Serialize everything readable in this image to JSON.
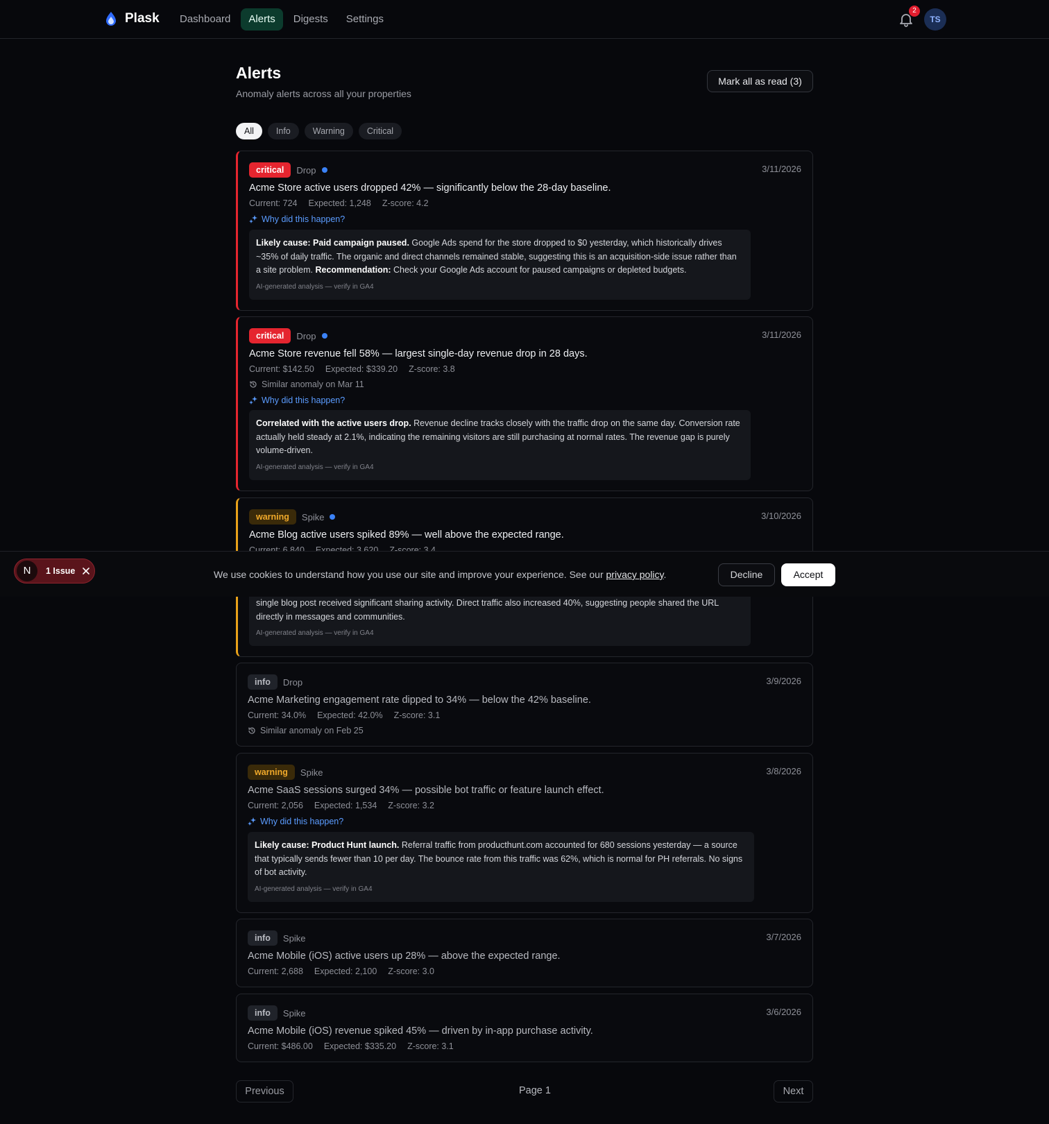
{
  "nav": {
    "brand": "Plask",
    "links": [
      "Dashboard",
      "Alerts",
      "Digests",
      "Settings"
    ],
    "notification_count": "2",
    "avatar_initials": "TS"
  },
  "header": {
    "title": "Alerts",
    "subtitle": "Anomaly alerts across all your properties",
    "mark_all_label": "Mark all as read (3)"
  },
  "filters": [
    "All",
    "Info",
    "Warning",
    "Critical"
  ],
  "alerts": [
    {
      "severity": "critical",
      "kind": "Drop",
      "date": "3/11/2026",
      "title": "Acme Store active users dropped 42% — significantly below the 28-day baseline.",
      "current": "Current: 724",
      "expected": "Expected: 1,248",
      "zscore": "Z-score: 4.2",
      "why": "Why did this happen?",
      "analysis_lead": "Likely cause: Paid campaign paused.",
      "analysis_body": " Google Ads spend for the store dropped to $0 yesterday, which historically drives ~35% of daily traffic. The organic and direct channels remained stable, suggesting this is an acquisition-side issue rather than a site problem. ",
      "analysis_rec_label": "Recommendation:",
      "analysis_rec": " Check your Google Ads account for paused campaigns or depleted budgets.",
      "note": "AI-generated analysis — verify in GA4"
    },
    {
      "severity": "critical",
      "kind": "Drop",
      "date": "3/11/2026",
      "title": "Acme Store revenue fell 58% — largest single-day revenue drop in 28 days.",
      "current": "Current: $142.50",
      "expected": "Expected: $339.20",
      "zscore": "Z-score: 3.8",
      "similar": "Similar anomaly on Mar 11",
      "why": "Why did this happen?",
      "analysis_lead": "Correlated with the active users drop.",
      "analysis_body": " Revenue decline tracks closely with the traffic drop on the same day. Conversion rate actually held steady at 2.1%, indicating the remaining visitors are still purchasing at normal rates. The revenue gap is purely volume-driven.",
      "note": "AI-generated analysis — verify in GA4"
    },
    {
      "severity": "warning",
      "kind": "Spike",
      "date": "3/10/2026",
      "title": "Acme Blog active users spiked 89% — well above the expected range.",
      "current": "Current: 6,840",
      "expected": "Expected: 3,620",
      "zscore": "Z-score: 3.4",
      "analysis_tail": "single blog post received significant sharing activity. Direct traffic also increased 40%, suggesting people shared the URL directly in messages and communities.",
      "note": "AI-generated analysis — verify in GA4"
    },
    {
      "severity": "info",
      "kind": "Drop",
      "date": "3/9/2026",
      "title": "Acme Marketing engagement rate dipped to 34% — below the 42% baseline.",
      "current": "Current: 34.0%",
      "expected": "Expected: 42.0%",
      "zscore": "Z-score: 3.1",
      "similar": "Similar anomaly on Feb 25"
    },
    {
      "severity": "warning",
      "kind": "Spike",
      "date": "3/8/2026",
      "title": "Acme SaaS sessions surged 34% — possible bot traffic or feature launch effect.",
      "current": "Current: 2,056",
      "expected": "Expected: 1,534",
      "zscore": "Z-score: 3.2",
      "why": "Why did this happen?",
      "analysis_lead": "Likely cause: Product Hunt launch.",
      "analysis_body": " Referral traffic from producthunt.com accounted for 680 sessions yesterday — a source that typically sends fewer than 10 per day. The bounce rate from this traffic was 62%, which is normal for PH referrals. No signs of bot activity.",
      "note": "AI-generated analysis — verify in GA4"
    },
    {
      "severity": "info",
      "kind": "Spike",
      "date": "3/7/2026",
      "title": "Acme Mobile (iOS) active users up 28% — above the expected range.",
      "current": "Current: 2,688",
      "expected": "Expected: 2,100",
      "zscore": "Z-score: 3.0"
    },
    {
      "severity": "info",
      "kind": "Spike",
      "date": "3/6/2026",
      "title": "Acme Mobile (iOS) revenue spiked 45% — driven by in-app purchase activity.",
      "current": "Current: $486.00",
      "expected": "Expected: $335.20",
      "zscore": "Z-score: 3.1"
    }
  ],
  "cookie": {
    "text": "We use cookies to understand how you use our site and improve your experience. See our ",
    "link": "privacy policy",
    "end": ".",
    "decline": "Decline",
    "accept": "Accept"
  },
  "issues": {
    "letter": "N",
    "label": "1 Issue"
  },
  "pagination": {
    "previous": "Previous",
    "page": "Page 1",
    "next": "Next"
  },
  "colors": {
    "critical": "#e5252f",
    "warning": "#e9a21a",
    "accent": "#3b82f6",
    "active_nav": "#0c3b2d"
  }
}
